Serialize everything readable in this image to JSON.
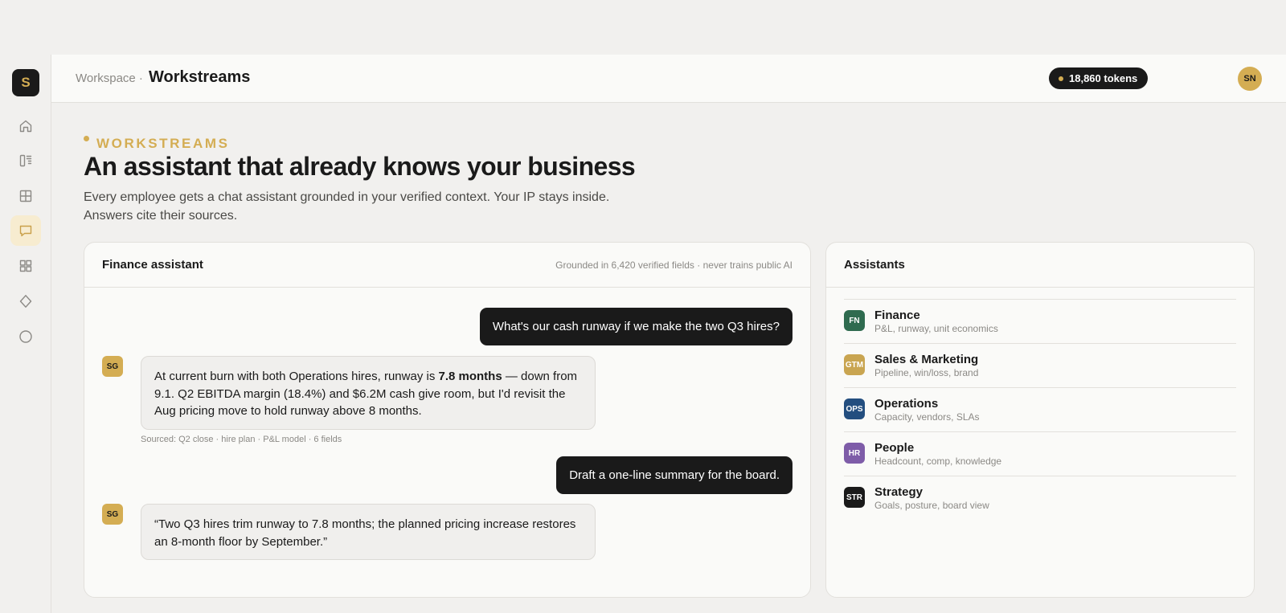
{
  "sidebar": {
    "logo": "S",
    "items": [
      {
        "icon": "home-icon",
        "active": false
      },
      {
        "icon": "document-list-icon",
        "active": false
      },
      {
        "icon": "grid-table-icon",
        "active": false
      },
      {
        "icon": "chat-icon",
        "active": true
      },
      {
        "icon": "apps-grid-icon",
        "active": false
      },
      {
        "icon": "diamond-icon",
        "active": false
      },
      {
        "icon": "circle-icon",
        "active": false
      }
    ]
  },
  "header": {
    "crumb": "Workspace ·",
    "title": "Workstreams",
    "tokens": "18,860 tokens",
    "avatar": "SN"
  },
  "hero": {
    "eyebrow": "WORKSTREAMS",
    "title": "An assistant that already knows your business",
    "subtitle": "Every employee gets a chat assistant grounded in your verified context. Your IP stays inside. Answers cite their sources."
  },
  "chat": {
    "title": "Finance assistant",
    "meta": "Grounded in 6,420 verified fields · never trains public AI",
    "bot_avatar": "SG",
    "messages": {
      "user1": "What's our cash runway if we make the two Q3 hires?",
      "bot1_pre": "At current burn with both Operations hires, runway is ",
      "bot1_bold": "7.8 months",
      "bot1_post": " — down from 9.1. Q2 EBITDA margin (18.4%) and $6.2M cash give room, but I'd revisit the Aug pricing move to hold runway above 8 months.",
      "source1": "Sourced: Q2 close · hire plan · P&L model · 6 fields",
      "user2": "Draft a one-line summary for the board.",
      "bot2": "“Two Q3 hires trim runway to 7.8 months; the planned pricing increase restores an 8-month floor by September.”"
    }
  },
  "assistants": {
    "title": "Assistants",
    "items": [
      {
        "badge": "FN",
        "name": "Finance",
        "desc": "P&L, runway, unit economics",
        "color": "#2f6b4f"
      },
      {
        "badge": "GTM",
        "name": "Sales & Marketing",
        "desc": "Pipeline, win/loss, brand",
        "color": "#c9a551"
      },
      {
        "badge": "OPS",
        "name": "Operations",
        "desc": "Capacity, vendors, SLAs",
        "color": "#234e7f"
      },
      {
        "badge": "HR",
        "name": "People",
        "desc": "Headcount, comp, knowledge",
        "color": "#7e5ca8"
      },
      {
        "badge": "STR",
        "name": "Strategy",
        "desc": "Goals, posture, board view",
        "color": "#1a1a1a"
      }
    ]
  },
  "colors": {
    "accent": "#d4ad53",
    "dark": "#1a1a1a",
    "active_nav": "#f7ecd0"
  }
}
